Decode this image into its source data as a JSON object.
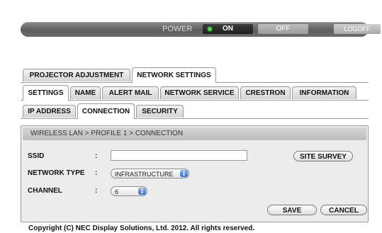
{
  "power": {
    "label": "POWER",
    "on_label": "ON",
    "off_label": "OFF",
    "logoff_label": "LOGOFF",
    "state": "on",
    "on_indicator_color": "#3edc3e"
  },
  "main_tabs": [
    {
      "label": "PROJECTOR ADJUSTMENT",
      "active": false
    },
    {
      "label": "NETWORK SETTINGS",
      "active": true
    }
  ],
  "sub_tabs": [
    {
      "label": "SETTINGS",
      "active": true
    },
    {
      "label": "NAME",
      "active": false
    },
    {
      "label": "ALERT MAIL",
      "active": false
    },
    {
      "label": "NETWORK SERVICE",
      "active": false
    },
    {
      "label": "CRESTRON",
      "active": false
    },
    {
      "label": "INFORMATION",
      "active": false
    }
  ],
  "settings_tabs": [
    {
      "label": "IP ADDRESS",
      "active": false
    },
    {
      "label": "CONNECTION",
      "active": true
    },
    {
      "label": "SECURITY",
      "active": false
    }
  ],
  "panel": {
    "breadcrumb": "WIRELESS LAN > PROFILE 1 > CONNECTION",
    "colon": ":",
    "ssid": {
      "label": "SSID",
      "value": "",
      "button": "SITE SURVEY"
    },
    "network_type": {
      "label": "NETWORK TYPE",
      "value": "INFRASTRUCTURE"
    },
    "channel": {
      "label": "CHANNEL",
      "value": "6"
    },
    "save_label": "SAVE",
    "cancel_label": "CANCEL"
  },
  "footer": {
    "copyright": "Copyright (C) NEC Display Solutions, Ltd. 2012. All rights reserved."
  }
}
